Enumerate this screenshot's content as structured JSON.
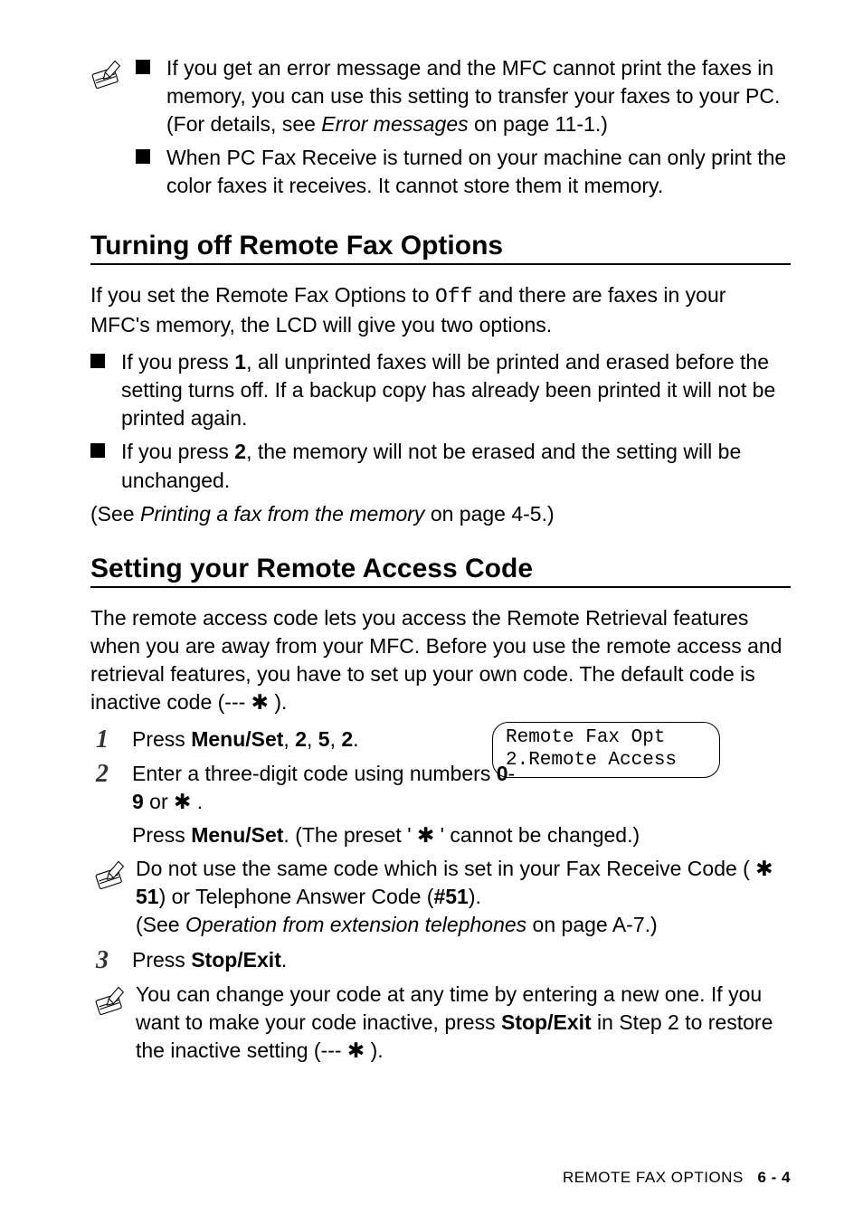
{
  "topnote": {
    "item1": "If you get an error message and the MFC cannot print the faxes in memory, you can use this setting to transfer your faxes to your PC. (For details, see ",
    "item1_ital": "Error messages",
    "item1_tail": " on page 11-1.)",
    "item2": "When PC Fax Receive is turned on your machine can only print the color faxes it receives. It cannot store them it memory."
  },
  "section1": {
    "heading": "Turning off Remote Fax Options",
    "intro_a": "If you set the Remote Fax Options to ",
    "intro_mono": "Off",
    "intro_b": " and there are faxes in your MFC's memory, the LCD will give you two options.",
    "b1_a": "If you press ",
    "b1_bold": "1",
    "b1_b": ", all unprinted faxes will be printed and erased before the setting turns off. If a backup copy has already been printed it will not be printed again.",
    "b2_a": "If you press ",
    "b2_bold": "2",
    "b2_b": ", the memory will not be erased and the setting will be unchanged.",
    "see_a": "(See ",
    "see_ital": "Printing a fax from the memory",
    "see_b": " on page 4-5.)"
  },
  "section2": {
    "heading": "Setting your Remote Access Code",
    "intro": "The remote access code lets you access the Remote Retrieval features when you are away from your MFC. Before you use the remote access and retrieval features, you have to set up your own code. The default code is inactive code (--- ✱ ).",
    "lcd_line1": "Remote Fax Opt",
    "lcd_line2": "2.Remote Access",
    "step1_a": "Press ",
    "step1_bold": "Menu/Set",
    "step1_b": ", ",
    "step1_k1": "2",
    "step1_c": ", ",
    "step1_k2": "5",
    "step1_d": ", ",
    "step1_k3": "2",
    "step1_e": ".",
    "step2_a": "Enter a three-digit code using numbers ",
    "step2_bold1": "0",
    "step2_dash": "-",
    "step2_bold2": "9",
    "step2_b": " or ✱ .",
    "step2_line2_a": "Press ",
    "step2_line2_bold": "Menu/Set",
    "step2_line2_b": ". (The preset ' ✱ ' cannot be changed.)",
    "note1_a": "Do not use the same code which is set in your Fax Receive Code ( ✱ ",
    "note1_bold1": "51",
    "note1_b": ") or Telephone Answer Code (",
    "note1_bold2": "#51",
    "note1_c": ").",
    "note1_see_a": "(See ",
    "note1_see_ital": "Operation from extension telephones",
    "note1_see_b": " on page A-7.)",
    "step3_a": "Press ",
    "step3_bold": "Stop/Exit",
    "step3_b": ".",
    "note2_a": "You can change your code at any time by entering a new one. If you want to make your code inactive, press ",
    "note2_bold": "Stop/Exit",
    "note2_b": " in Step 2 to restore the inactive setting (--- ✱ )."
  },
  "footer": {
    "label": "REMOTE FAX OPTIONS",
    "page": "6 - 4"
  }
}
